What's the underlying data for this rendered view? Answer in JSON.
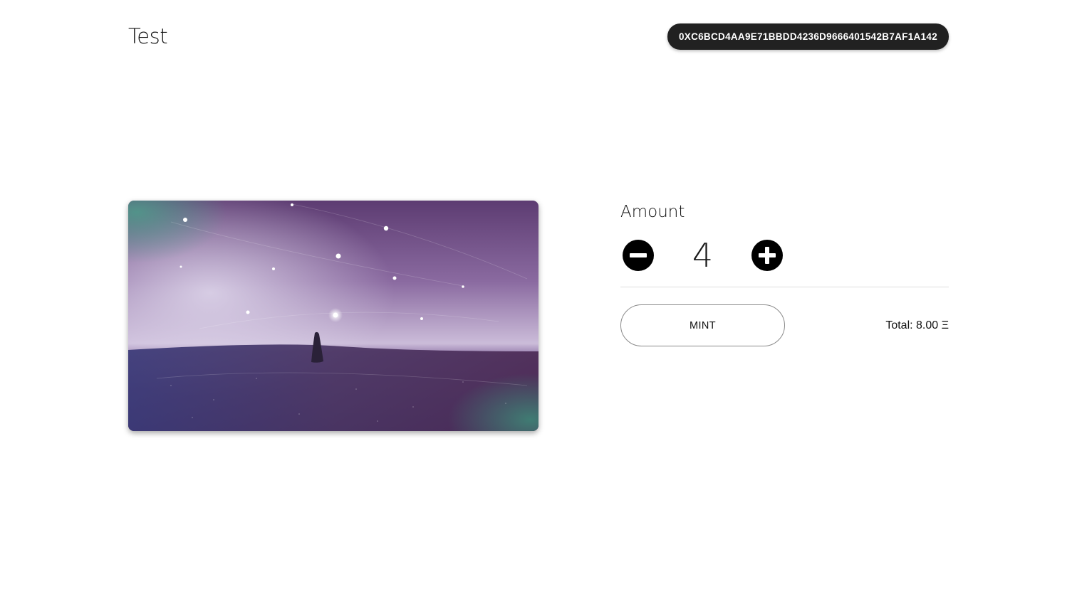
{
  "header": {
    "title": "Test",
    "wallet_address": "0XC6BCD4AA9E71BBDD4236D9666401542B7AF1A142"
  },
  "mint": {
    "amount_label": "Amount",
    "amount_value": "4",
    "mint_button_label": "MINT",
    "total_label": "Total: 8.00 Ξ"
  },
  "artwork": {
    "description_colors": {
      "sky_top": "#5a3a6e",
      "sky_horizon": "#c9b9d9",
      "ground": "#3e2e5c",
      "teal_glow": "#4f9a8a"
    }
  }
}
